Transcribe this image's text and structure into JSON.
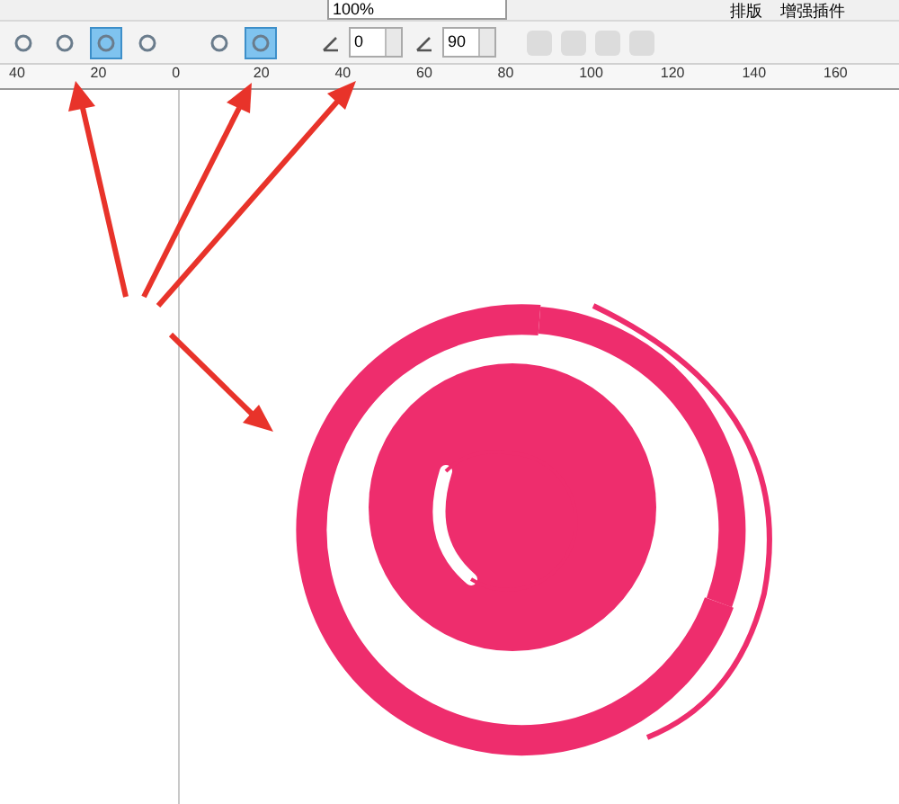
{
  "toolbar_top": {
    "zoom": "100%",
    "buttons": [
      "排版",
      "增强插件"
    ]
  },
  "property_bar": {
    "buttons": [
      {
        "selected": false
      },
      {
        "selected": false
      },
      {
        "selected": true
      },
      {
        "selected": false
      },
      {
        "selected": false
      },
      {
        "selected": true
      }
    ],
    "angle": "0",
    "sweep": "90"
  },
  "ruler": {
    "labels": [
      "40",
      "20",
      "0",
      "20",
      "40",
      "60",
      "80",
      "100",
      "120",
      "140",
      "160"
    ]
  }
}
